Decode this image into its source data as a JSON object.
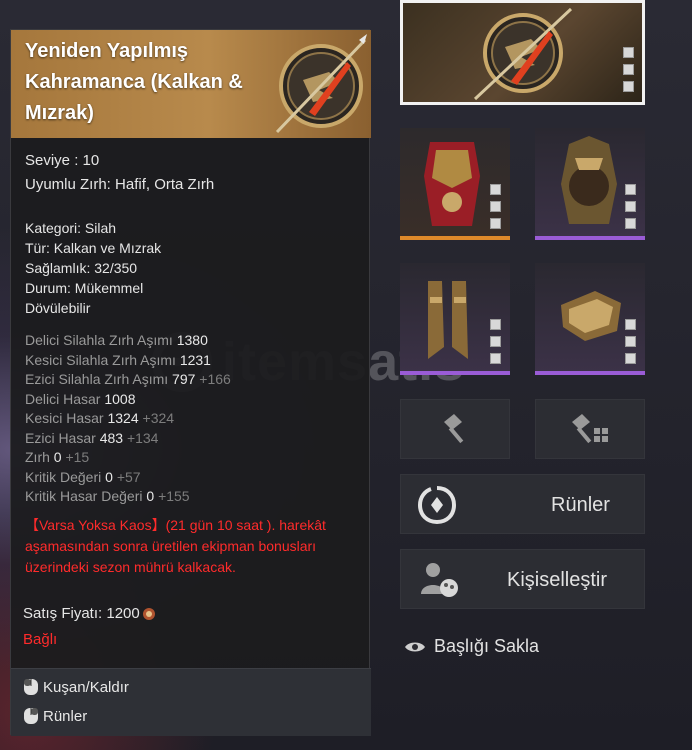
{
  "item": {
    "title": "Yeniden Yapılmış Kahramanca (Kalkan & Mızrak)",
    "level": "Seviye : 10",
    "armor_compat": "Uyumlu Zırh: Hafif, Orta Zırh",
    "category": "Kategori: Silah",
    "type": "Tür: Kalkan ve Mızrak",
    "durability": "Sağlamlık: 32/350",
    "condition": "Durum: Mükemmel",
    "forgeable": "Dövülebilir"
  },
  "stats": [
    {
      "label": "Delici Silahla Zırh Aşımı",
      "value": "1380",
      "bonus": ""
    },
    {
      "label": "Kesici Silahla Zırh Aşımı",
      "value": "1231",
      "bonus": ""
    },
    {
      "label": "Ezici Silahla Zırh Aşımı",
      "value": "797",
      "bonus": "+166"
    },
    {
      "label": "Delici Hasar",
      "value": "1008",
      "bonus": ""
    },
    {
      "label": "Kesici Hasar",
      "value": "1324",
      "bonus": "+324"
    },
    {
      "label": "Ezici Hasar",
      "value": "483",
      "bonus": "+134"
    },
    {
      "label": "Zırh",
      "value": "0",
      "bonus": "+15"
    },
    {
      "label": "Kritik Değeri",
      "value": "0",
      "bonus": "+57"
    },
    {
      "label": "Kritik Hasar Değeri",
      "value": "0",
      "bonus": "+155"
    }
  ],
  "season_note": {
    "line1": "【Varsa Yoksa Kaos】(21 gün 10 saat ). harekât",
    "line2": "aşamasından sonra üretilen ekipman bonusları",
    "line3": "üzerindeki sezon mührü kalkacak."
  },
  "sale_price": "Satış Fiyatı: 1200",
  "bound": "Bağlı",
  "footer": {
    "equip": "Kuşan/Kaldır",
    "runes": "Rünler"
  },
  "buttons": {
    "runes": "Rünler",
    "customize": "Kişiselleştir",
    "hide_title": "Başlığı Sakla"
  },
  "watermark": "itemsatis",
  "colors": {
    "header_gold": "#b88a4c",
    "warning_red": "#ff2b2b",
    "rarity_orange": "#e08a2a",
    "rarity_purple": "#9a5cd6"
  },
  "icons": [
    "shield-spear-icon",
    "chest-armor-icon",
    "helmet-icon",
    "boots-icon",
    "gauntlet-icon",
    "hammer-icon",
    "hammer-grid-icon",
    "rune-icon",
    "customize-icon",
    "eye-icon",
    "mouse-icon",
    "coin-icon"
  ]
}
